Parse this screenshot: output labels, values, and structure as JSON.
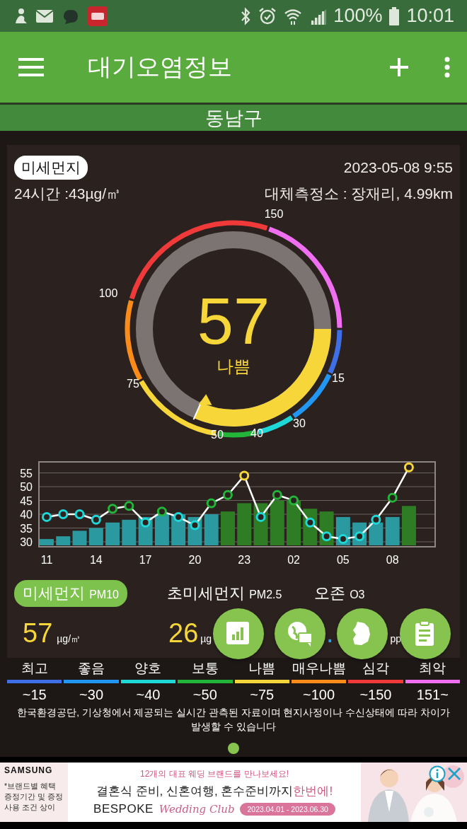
{
  "status_bar": {
    "battery": "100%",
    "time": "10:01"
  },
  "app_bar": {
    "title": "대기오염정보"
  },
  "location": "동남구",
  "summary": {
    "pollutant_label": "미세먼지",
    "timestamp": "2023-05-08 9:55",
    "average_24h": "24시간 :43µg/㎥",
    "station": "대체측정소 : 장재리, 4.99km"
  },
  "gauge": {
    "value": "57",
    "grade": "나쁨",
    "color": "#f7d63a",
    "scale_labels": [
      "15",
      "30",
      "40",
      "50",
      "75",
      "100",
      "150"
    ]
  },
  "chart": {
    "chart_data": {
      "type": "bar",
      "categories": [
        "11",
        null,
        null,
        "14",
        null,
        null,
        "17",
        null,
        null,
        "20",
        null,
        null,
        "23",
        null,
        null,
        "02",
        null,
        null,
        "05",
        null,
        null,
        "08",
        null
      ],
      "yticks": [
        30,
        35,
        40,
        45,
        50,
        55
      ],
      "ylim": [
        28.2,
        59
      ],
      "grid": true,
      "series": [
        {
          "type": "bar",
          "values": [
            31,
            32,
            34,
            35,
            37,
            38,
            39,
            40,
            40,
            39,
            40,
            41,
            44,
            44,
            45,
            45,
            42,
            41,
            39,
            37,
            37,
            39,
            43
          ],
          "colors": [
            "#2a9aa0",
            "#2a9aa0",
            "#2a9aa0",
            "#2a9aa0",
            "#2a9aa0",
            "#2a9aa0",
            "#2a9aa0",
            "#2a9aa0",
            "#2a9aa0",
            "#2a9aa0",
            "#2a9aa0",
            "#2e7d24",
            "#2e7d24",
            "#2e7d24",
            "#2e7d24",
            "#2e7d24",
            "#2e7d24",
            "#2e7d24",
            "#2a9aa0",
            "#2a9aa0",
            "#2a9aa0",
            "#2a9aa0",
            "#2e7d24"
          ]
        },
        {
          "type": "line",
          "color": "#ffffff",
          "marker": "circle",
          "values": [
            39,
            40,
            40,
            38,
            42,
            43,
            37,
            41,
            39,
            36,
            44,
            47,
            54,
            39,
            47,
            45,
            37,
            32,
            31,
            32,
            38,
            46,
            57
          ],
          "colors": [
            "#1ed8d8",
            "#1ed8d8",
            "#1ed8d8",
            "#1ed8d8",
            "#22b53a",
            "#22b53a",
            "#1ed8d8",
            "#22b53a",
            "#1ed8d8",
            "#1ed8d8",
            "#22b53a",
            "#22b53a",
            "#f7d63a",
            "#1ed8d8",
            "#22b53a",
            "#22b53a",
            "#1ed8d8",
            "#1ed8d8",
            "#1ed8d8",
            "#1ed8d8",
            "#1ed8d8",
            "#22b53a",
            "#f7d63a"
          ]
        }
      ]
    }
  },
  "pollutant_tabs": [
    {
      "name": "미세먼지",
      "code": "PM10",
      "selected": true,
      "value": "57",
      "unit": "µg/㎥",
      "color": "#f7d63a"
    },
    {
      "name": "초미세먼지",
      "code": "PM2.5",
      "selected": false,
      "value": "26",
      "unit": "µg",
      "color": "#f7d63a"
    },
    {
      "name": "오존",
      "code": "O3",
      "selected": false,
      "value": ".",
      "unit": "pp",
      "color": "#2a9ff0"
    }
  ],
  "legend": [
    {
      "label": "최고",
      "range": "~15",
      "color": "#3f6fe6"
    },
    {
      "label": "좋음",
      "range": "~30",
      "color": "#2196f3"
    },
    {
      "label": "양호",
      "range": "~40",
      "color": "#1ed8d8"
    },
    {
      "label": "보통",
      "range": "~50",
      "color": "#22b53a"
    },
    {
      "label": "나쁨",
      "range": "~75",
      "color": "#f7d63a"
    },
    {
      "label": "매우나쁨",
      "range": "~100",
      "color": "#fb8c1a"
    },
    {
      "label": "심각",
      "range": "~150",
      "color": "#f03a3a"
    },
    {
      "label": "최악",
      "range": "151~",
      "color": "#ef6ff0"
    }
  ],
  "disclaimer": "한국환경공단, 기상청에서 제공되는 실시간 관측된 자료이며 현지사정이나 수신상태에 따라 차이가 발생할 수 있습니다",
  "ad": {
    "brand": "SAMSUNG",
    "notes": [
      "*브랜드별 혜택",
      "증정기간 및 증정",
      "사용 조건 상이"
    ],
    "tagline": "12개의 대표 웨딩 브랜드를 만나보세요!",
    "headline": "결혼식 준비, 신혼여행, 혼수준비까지 ",
    "highlight": "한번에!",
    "logo": "BESPOKE",
    "logo_script": "Wedding Club",
    "period": "2023.04.01 - 2023.06.30"
  }
}
